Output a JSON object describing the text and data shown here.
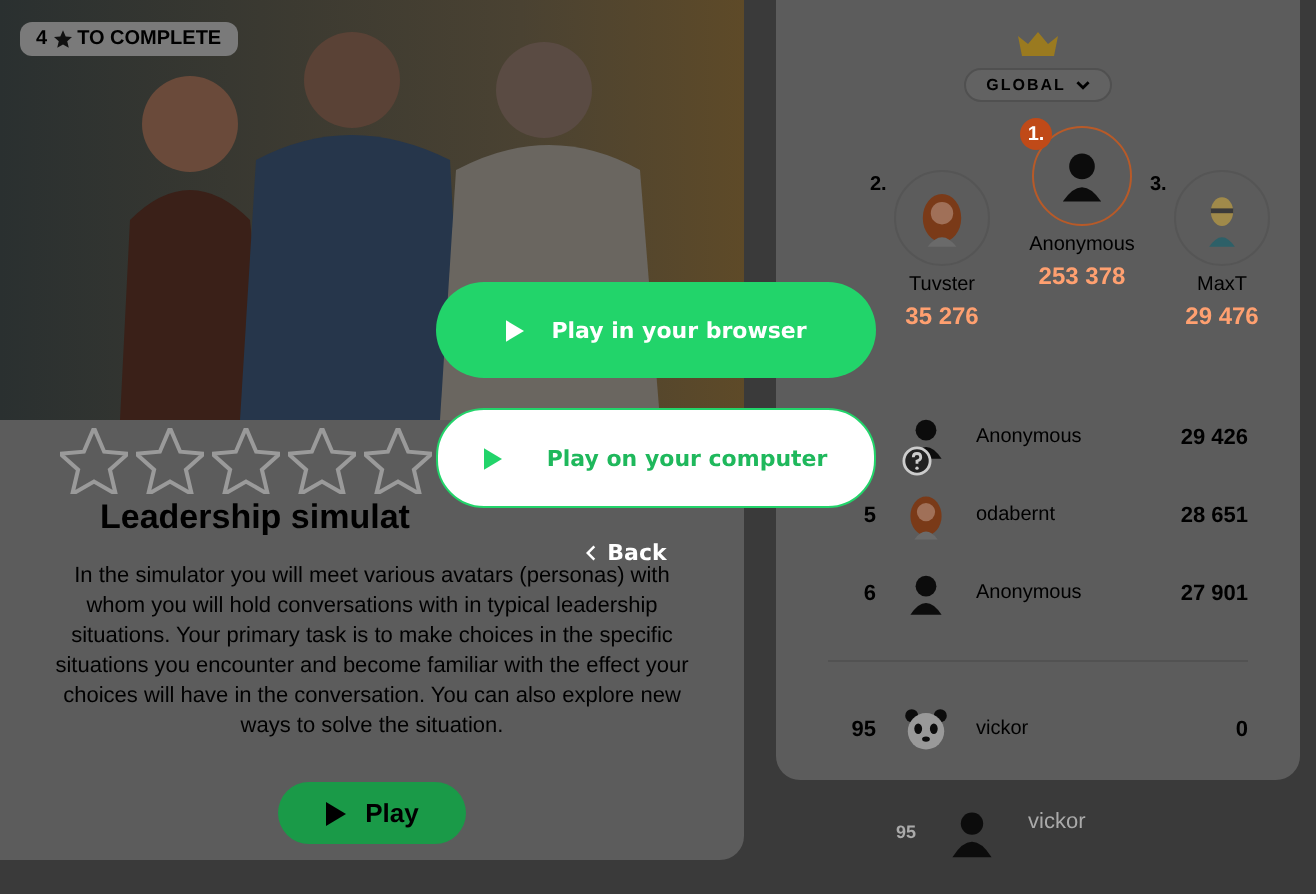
{
  "challenge": {
    "badge_count": "4",
    "badge_text": "TO COMPLETE",
    "stars": 0,
    "title": "Leadership simulat",
    "description": "In the simulator you will meet various avatars (personas) with whom you will hold conversations with in typical leadership situations. Your primary task is to make choices in the specific situations you encounter and become familiar with the effect your choices will have in the conversation. You can also explore new ways to solve the situation.",
    "play_label": "Play"
  },
  "leaderboard": {
    "scope": "GLOBAL",
    "podium": [
      {
        "rank": "2.",
        "name": "Tuvster",
        "score": "35 276",
        "kind": "woman",
        "first": false
      },
      {
        "rank": "1.",
        "name": "Anonymous",
        "score": "253 378",
        "kind": "anonymous",
        "first": true
      },
      {
        "rank": "3.",
        "name": "MaxT",
        "score": "29 476",
        "kind": "man",
        "first": false
      }
    ],
    "rows": [
      {
        "name": "Anonymous",
        "score": "29 426",
        "kind": "anonymous"
      },
      {
        "rank": "5",
        "name": "odabernt",
        "score": "28 651",
        "kind": "woman"
      },
      {
        "rank": "6",
        "name": "Anonymous",
        "score": "27 901",
        "kind": "anonymous"
      }
    ],
    "current": {
      "rank": "95",
      "name": "vickor",
      "score": "0",
      "kind": "panda"
    }
  },
  "background_row": {
    "rank": "95",
    "name": "vickor",
    "kind": "anonymous"
  },
  "modal": {
    "buttons": [
      {
        "label": "Play in your browser",
        "kind": "primary"
      },
      {
        "label": "Play on your computer",
        "kind": "secondary"
      }
    ],
    "back": "Back"
  }
}
